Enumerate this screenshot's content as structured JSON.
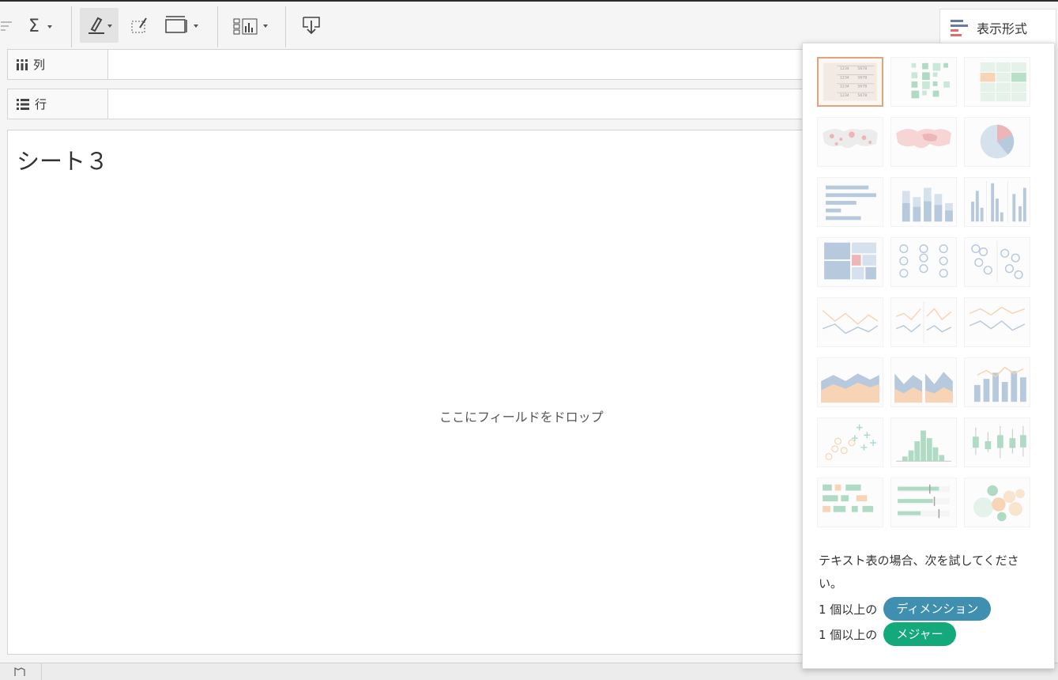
{
  "shelves": {
    "columns_label": "列",
    "rows_label": "行"
  },
  "sheet": {
    "title": "シート３",
    "drop_hint": "ここにフィールドをドロップ"
  },
  "show_me": {
    "title": "表示形式",
    "hint": "テキスト表の場合、次を試してください。",
    "requirements": [
      {
        "prefix": "1 個以上の",
        "pill": "ディメンション",
        "color": "#3f8fb0"
      },
      {
        "prefix": "1 個以上の",
        "pill": "メジャー",
        "color": "#14a97a"
      }
    ],
    "chart_types": [
      "text-table-icon",
      "heat-map-icon",
      "highlight-table-icon",
      "symbol-map-icon",
      "filled-map-icon",
      "pie-chart-icon",
      "horizontal-bars-icon",
      "stacked-bars-icon",
      "side-by-side-bars-icon",
      "treemap-icon",
      "circle-views-icon",
      "side-by-side-circles-icon",
      "lines-continuous-icon",
      "lines-discrete-icon",
      "dual-lines-icon",
      "area-continuous-icon",
      "area-discrete-icon",
      "dual-combination-icon",
      "scatter-plot-icon",
      "histogram-icon",
      "box-and-whisker-icon",
      "gantt-chart-icon",
      "bullet-graph-icon",
      "packed-bubbles-icon"
    ],
    "selected_index": 0
  }
}
